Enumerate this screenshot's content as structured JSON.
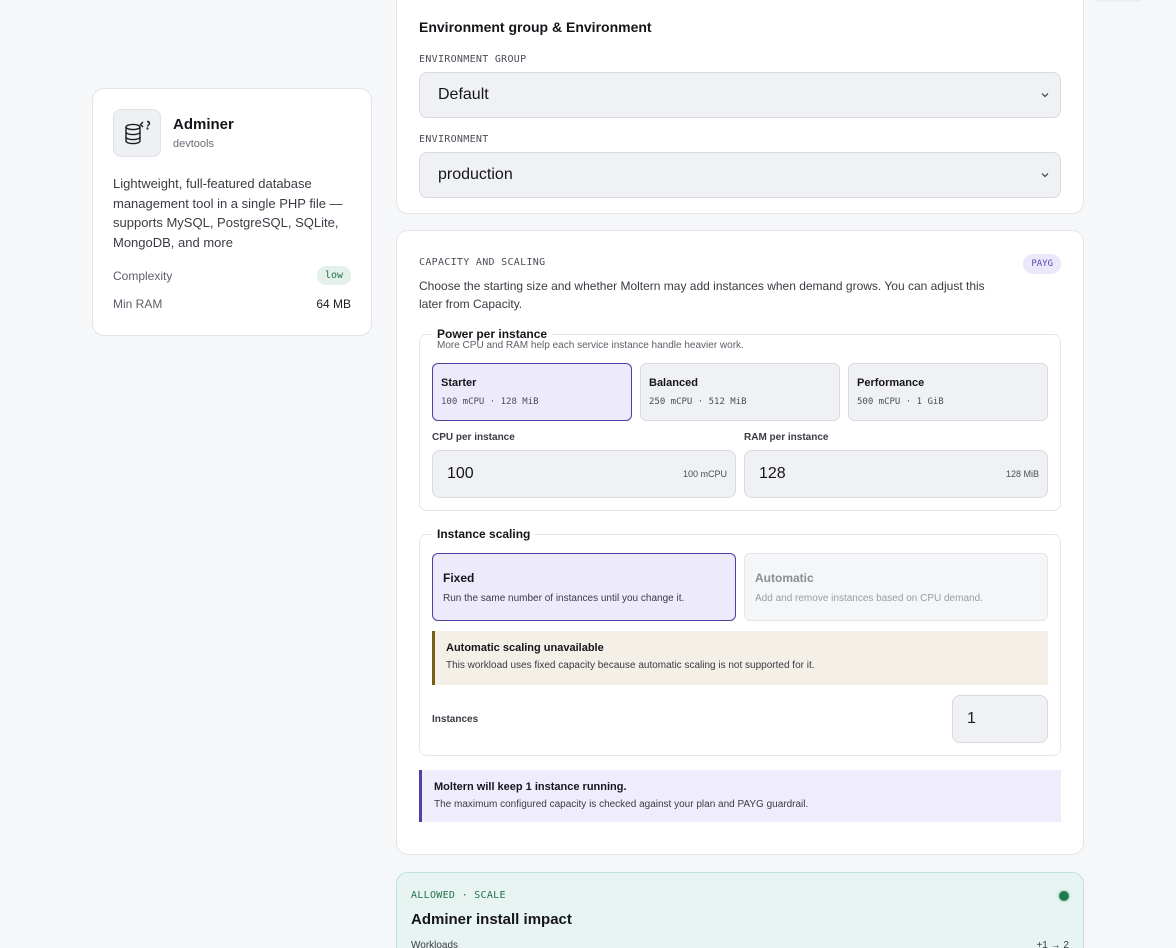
{
  "app": {
    "name": "Adminer",
    "category": "devtools",
    "description": "Lightweight, full-featured database management tool in a single PHP file — supports MySQL, PostgreSQL, SQLite, MongoDB, and more",
    "complexity_label": "Complexity",
    "complexity_value": "low",
    "min_ram_label": "Min RAM",
    "min_ram_value": "64 MB",
    "icon": "database-code-icon"
  },
  "environment": {
    "title": "Environment group & Environment",
    "group_label": "ENVIRONMENT GROUP",
    "group_value": "Default",
    "env_label": "ENVIRONMENT",
    "env_value": "production"
  },
  "capacity": {
    "label": "CAPACITY AND SCALING",
    "badge": "PAYG",
    "description": "Choose the starting size and whether Moltern may add instances when demand grows. You can adjust this later from Capacity.",
    "power": {
      "title": "Power per instance",
      "subtitle": "More CPU and RAM help each service instance handle heavier work.",
      "tiers": [
        {
          "name": "Starter",
          "spec": "100 mCPU · 128 MiB",
          "selected": true
        },
        {
          "name": "Balanced",
          "spec": "250 mCPU · 512 MiB",
          "selected": false
        },
        {
          "name": "Performance",
          "spec": "500 mCPU · 1 GiB",
          "selected": false
        }
      ],
      "cpu_label": "CPU per instance",
      "cpu_value": "100",
      "cpu_unit": "100 mCPU",
      "ram_label": "RAM per instance",
      "ram_value": "128",
      "ram_unit": "128 MiB"
    },
    "scaling": {
      "title": "Instance scaling",
      "modes": [
        {
          "name": "Fixed",
          "desc": "Run the same number of instances until you change it.",
          "selected": true
        },
        {
          "name": "Automatic",
          "desc": "Add and remove instances based on CPU demand.",
          "selected": false
        }
      ],
      "warning_title": "Automatic scaling unavailable",
      "warning_desc": "This workload uses fixed capacity because automatic scaling is not supported for it.",
      "instances_label": "Instances",
      "instances_value": "1"
    },
    "note_title": "Moltern will keep 1 instance running.",
    "note_desc": "The maximum configured capacity is checked against your plan and PAYG guardrail."
  },
  "impact": {
    "label": "ALLOWED · SCALE",
    "title": "Adminer install impact",
    "row_label": "Workloads",
    "row_value": "+1 → 2"
  },
  "colors": {
    "accent": "#4f3fa6",
    "success": "#1f7a4d",
    "warning": "#7a5c17"
  }
}
